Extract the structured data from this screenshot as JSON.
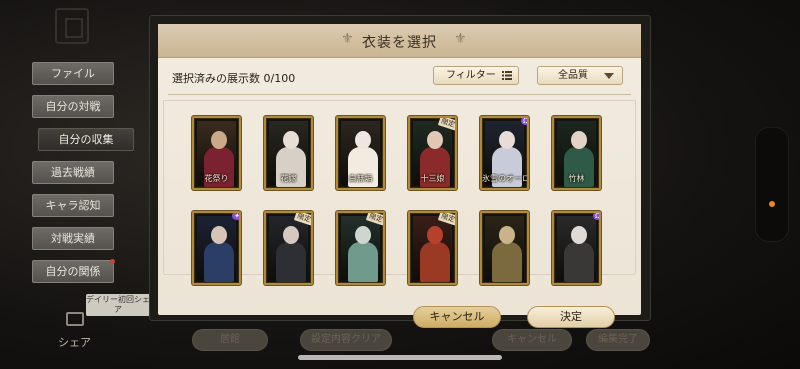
{
  "background": {
    "side_menu": [
      {
        "label": "ファイル",
        "active": false,
        "dot": false
      },
      {
        "label": "自分の対戦",
        "active": false,
        "dot": false
      },
      {
        "label": "自分の収集",
        "active": true,
        "dot": false
      },
      {
        "label": "過去戦績",
        "active": false,
        "dot": false
      },
      {
        "label": "キャラ認知",
        "active": false,
        "dot": false
      },
      {
        "label": "対戦実績",
        "active": false,
        "dot": false
      },
      {
        "label": "自分の関係",
        "active": false,
        "dot": true
      }
    ],
    "daily_tag": "デイリー初回シェア",
    "share_label": "シェア",
    "bottom_tabs": [
      "居館",
      "設定内容クリア",
      "キャンセル",
      "編集完了"
    ]
  },
  "modal": {
    "title": "衣装を選択",
    "selected_count": "選択済みの展示数 0/100",
    "filter_label": "フィルター",
    "quality_label": "全品質",
    "cancel_label": "キャンセル",
    "confirm_label": "決定",
    "cards": [
      {
        "name": "花祭り",
        "ltd": "",
        "badge": "",
        "bg": "#3a2b1e",
        "head": "#c9a98a",
        "body": "#7a2230"
      },
      {
        "name": "花嫁",
        "ltd": "",
        "badge": "",
        "bg": "#2a2622",
        "head": "#e8ded6",
        "body": "#d6d0c6"
      },
      {
        "name": "白無垢",
        "ltd": "",
        "badge": "",
        "bg": "#2c2620",
        "head": "#efe6df",
        "body": "#f2ebe0"
      },
      {
        "name": "十三娘",
        "ltd": "限定",
        "badge": "",
        "bg": "#1f2a22",
        "head": "#e0c8b4",
        "body": "#8a2a2a"
      },
      {
        "name": "氷雪のオーロラ",
        "ltd": "",
        "badge": "Ω",
        "bg": "#1e2430",
        "head": "#e7dcd6",
        "body": "#c7ccd8"
      },
      {
        "name": "竹林",
        "ltd": "",
        "badge": "",
        "bg": "#1d2620",
        "head": "#e3d3c6",
        "body": "#2f5a48"
      },
      {
        "name": "",
        "ltd": "",
        "badge": "✦",
        "bg": "#1a2234",
        "head": "#d8c4b6",
        "body": "#2b3e66"
      },
      {
        "name": "",
        "ltd": "限定",
        "badge": "",
        "bg": "#23262c",
        "head": "#d6c8be",
        "body": "#2d2f35"
      },
      {
        "name": "",
        "ltd": "限定",
        "badge": "",
        "bg": "#22302c",
        "head": "#cfd6cf",
        "body": "#6f9a8c"
      },
      {
        "name": "",
        "ltd": "限定",
        "badge": "",
        "bg": "#3a1e18",
        "head": "#b7402d",
        "body": "#9a3a24"
      },
      {
        "name": "",
        "ltd": "",
        "badge": "",
        "bg": "#2a2418",
        "head": "#c9b48a",
        "body": "#7b6a3e"
      },
      {
        "name": "",
        "ltd": "",
        "badge": "Ω",
        "bg": "#2a2a2c",
        "head": "#e0dad6",
        "body": "#3a3836"
      }
    ]
  },
  "colors": {
    "accent_gold": "#b08a3b",
    "paper": "#f2ece1",
    "notification_orange": "#e88a1b"
  }
}
